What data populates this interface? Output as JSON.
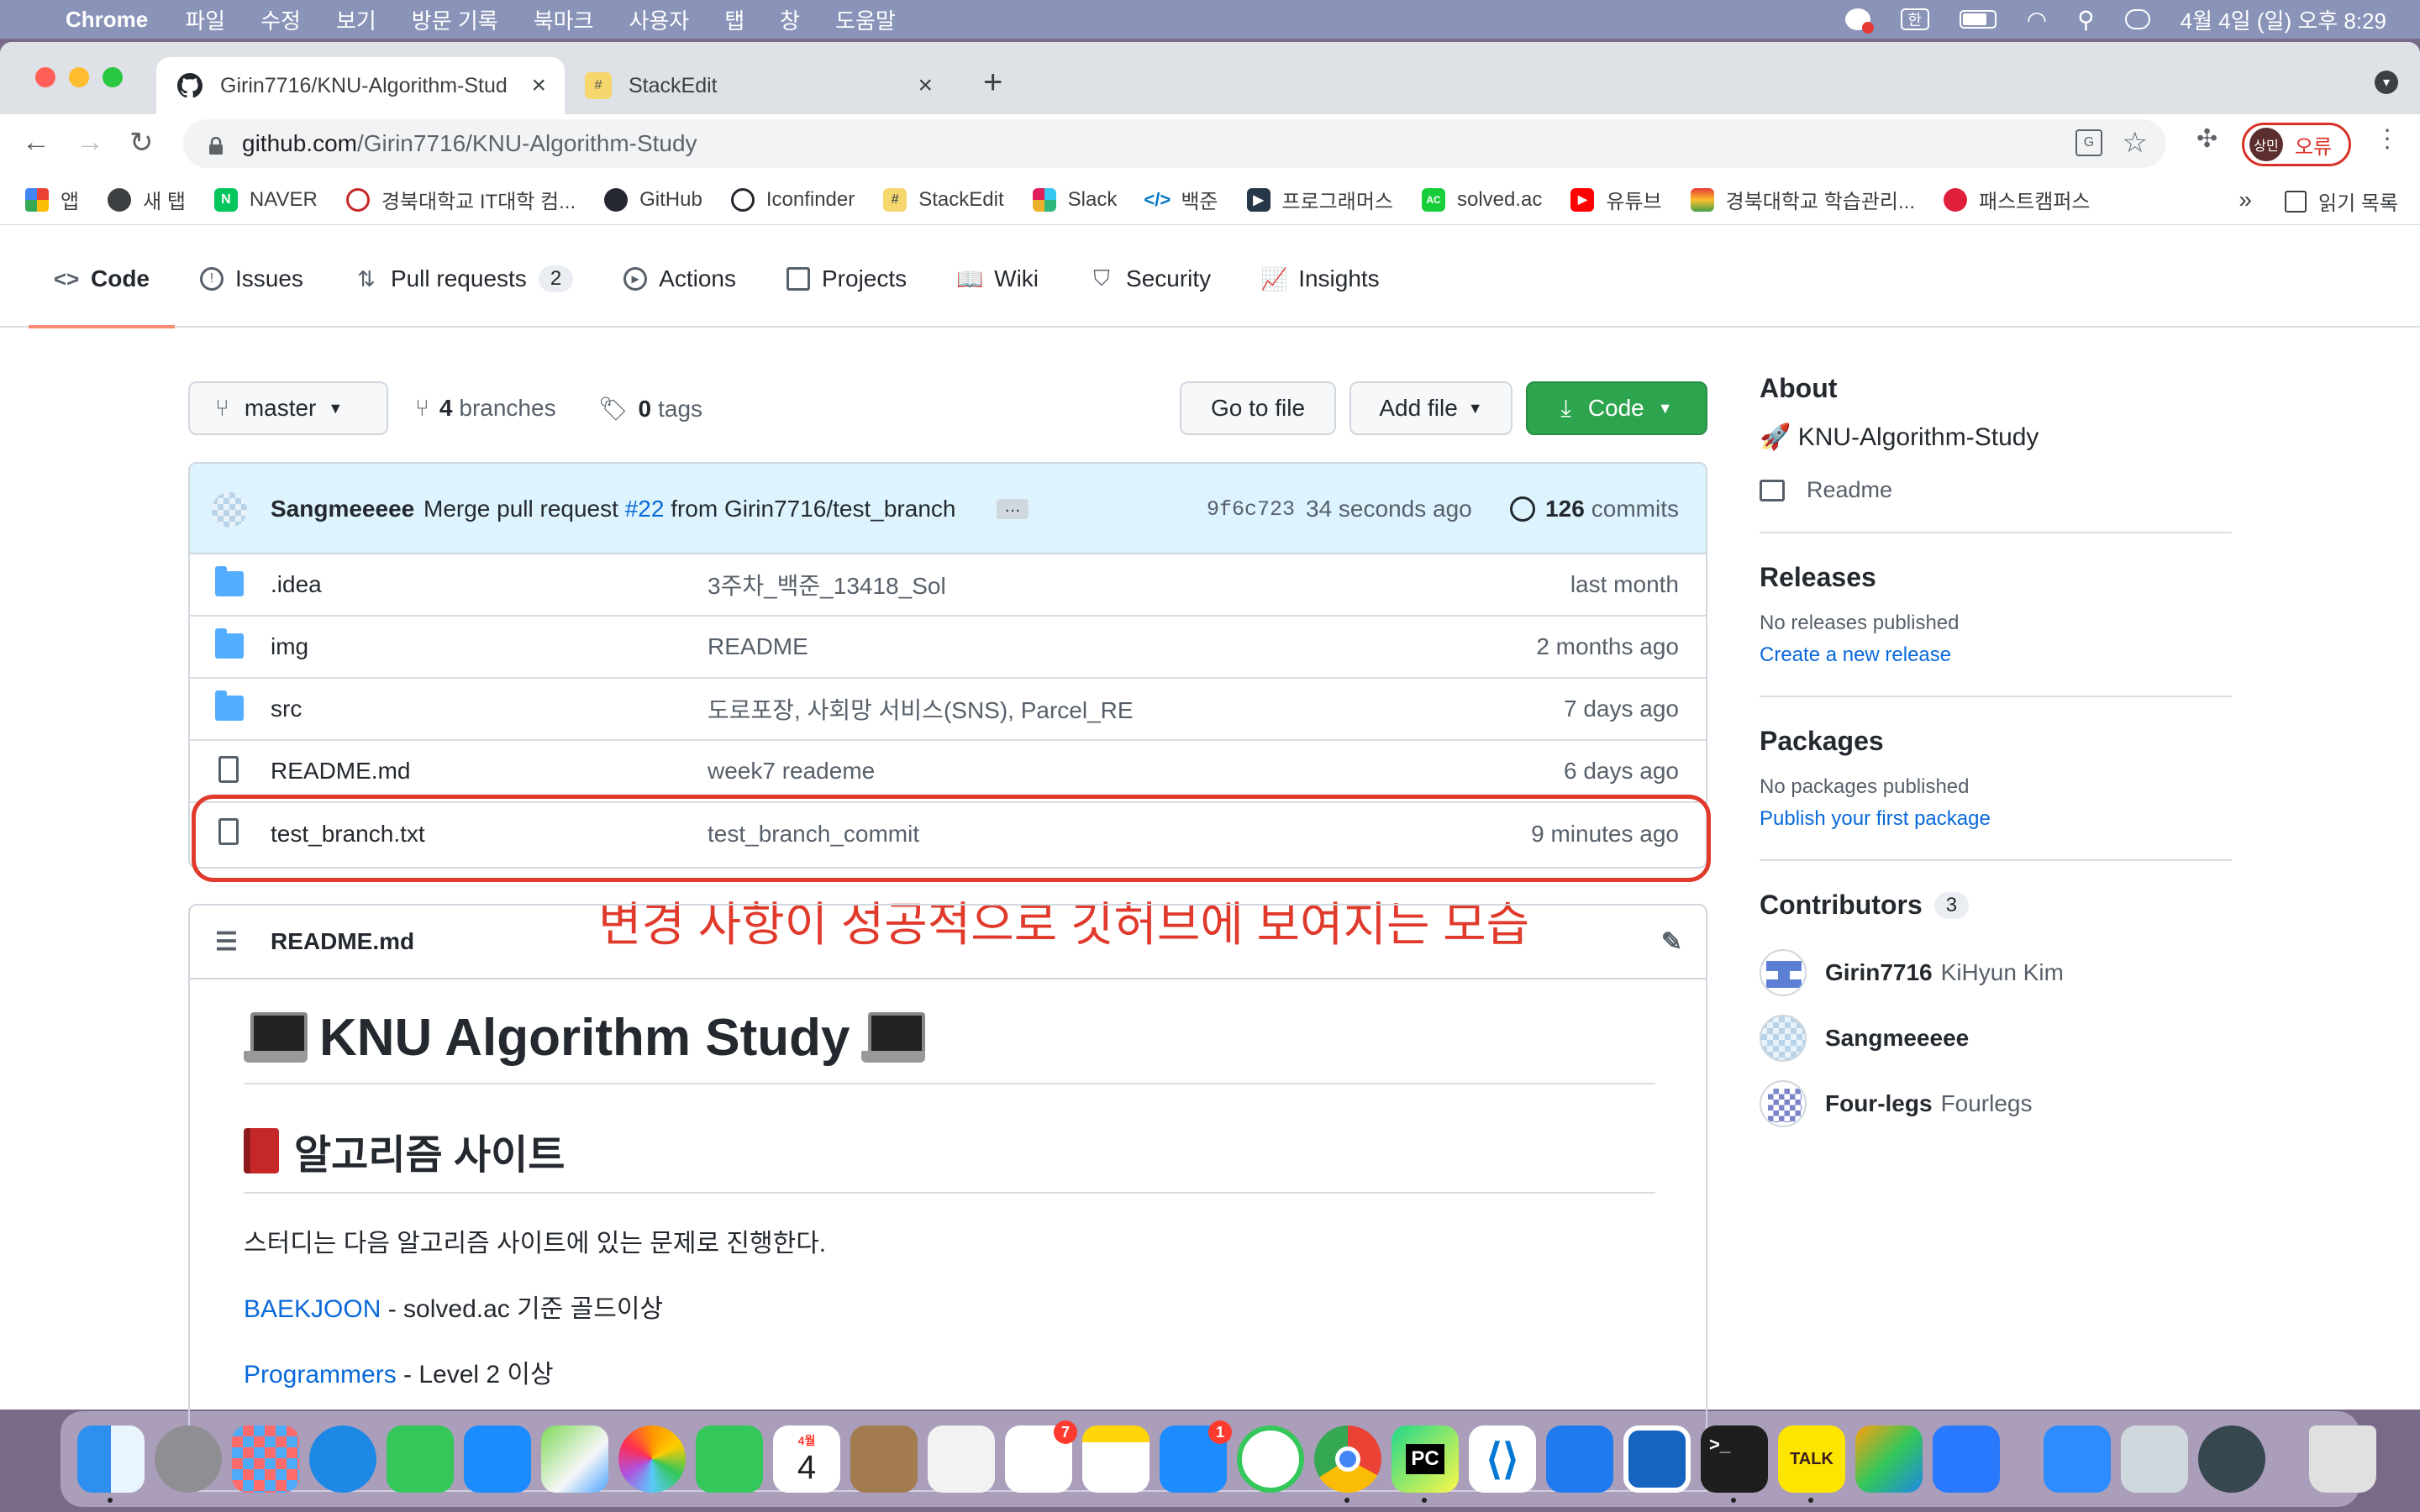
{
  "menubar": {
    "app": "Chrome",
    "items": [
      "파일",
      "수정",
      "보기",
      "방문 기록",
      "북마크",
      "사용자",
      "탭",
      "창",
      "도움말"
    ],
    "ime": "한",
    "clock": "4월 4일 (일) 오후 8:29"
  },
  "tabs": [
    {
      "title": "Girin7716/KNU-Algorithm-Stud"
    },
    {
      "title": "StackEdit"
    }
  ],
  "omnibox": {
    "host": "github.com",
    "path": "/Girin7716/KNU-Algorithm-Study"
  },
  "profile": {
    "avatar": "상민",
    "label": "오류"
  },
  "bookmarks": [
    {
      "label": "앱"
    },
    {
      "label": "새 탭"
    },
    {
      "label": "NAVER"
    },
    {
      "label": "경북대학교 IT대학 컴..."
    },
    {
      "label": "GitHub"
    },
    {
      "label": "Iconfinder"
    },
    {
      "label": "StackEdit"
    },
    {
      "label": "Slack"
    },
    {
      "label": "백준"
    },
    {
      "label": "프로그래머스"
    },
    {
      "label": "solved.ac"
    },
    {
      "label": "유튜브"
    },
    {
      "label": "경북대학교 학습관리..."
    },
    {
      "label": "패스트캠퍼스"
    }
  ],
  "bookmarks_more": "»",
  "reading_list": "읽기 목록",
  "repo_tabs": [
    {
      "label": "Code"
    },
    {
      "label": "Issues"
    },
    {
      "label": "Pull requests",
      "count": "2"
    },
    {
      "label": "Actions"
    },
    {
      "label": "Projects"
    },
    {
      "label": "Wiki"
    },
    {
      "label": "Security"
    },
    {
      "label": "Insights"
    }
  ],
  "controls": {
    "branch": "master",
    "branches_count": "4",
    "branches_label": "branches",
    "tags_count": "0",
    "tags_label": "tags",
    "go_to_file": "Go to file",
    "add_file": "Add file",
    "code": "Code"
  },
  "commit": {
    "author": "Sangmeeeee",
    "message_pre": "Merge pull request",
    "pr": "#22",
    "message_post": "from Girin7716/test_branch",
    "more": "…",
    "sha": "9f6c723",
    "age": "34 seconds ago",
    "count": "126",
    "count_label": "commits"
  },
  "files": [
    {
      "type": "dir",
      "name": ".idea",
      "message": "3주차_백준_13418_Sol",
      "age": "last month"
    },
    {
      "type": "dir",
      "name": "img",
      "message": "README",
      "age": "2 months ago"
    },
    {
      "type": "dir",
      "name": "src",
      "message": "도로포장, 사회망 서비스(SNS), Parcel_RE",
      "age": "7 days ago"
    },
    {
      "type": "file",
      "name": "README.md",
      "message": "week7 reademe",
      "age": "6 days ago"
    },
    {
      "type": "file",
      "name": "test_branch.txt",
      "message": "test_branch_commit",
      "age": "9 minutes ago"
    }
  ],
  "annotation": "변경 사항이 성공적으로 깃허브에 보여지는 모습",
  "readme": {
    "filename": "README.md",
    "h1": "KNU Algorithm Study",
    "h2": "알고리즘 사이트",
    "p1": "스터디는 다음 알고리즘 사이트에 있는 문제로 진행한다.",
    "link1": "BAEKJOON",
    "link1_rest": " - solved.ac 기준 골드이상",
    "link2": "Programmers",
    "link2_rest": " - Level 2 이상"
  },
  "about": {
    "heading": "About",
    "description": "🚀 KNU-Algorithm-Study",
    "readme": "Readme"
  },
  "releases": {
    "heading": "Releases",
    "none": "No releases published",
    "link": "Create a new release"
  },
  "packages": {
    "heading": "Packages",
    "none": "No packages published",
    "link": "Publish your first package"
  },
  "contributors": {
    "heading": "Contributors",
    "count": "3",
    "people": [
      {
        "login": "Girin7716",
        "name": "KiHyun Kim"
      },
      {
        "login": "Sangmeeeee",
        "name": ""
      },
      {
        "login": "Four-legs",
        "name": "Fourlegs"
      }
    ]
  },
  "dock": {
    "calendar_month": "4월",
    "calendar_day": "4",
    "reminders_badge": "7",
    "appstore_badge": "1",
    "terminal_prompt": ">_",
    "kakao": "TALK",
    "pycharm": "PC"
  },
  "colors": {
    "accent": "#0969da",
    "green": "#2da44e",
    "annotation": "#e03a2c",
    "tab_underline": "#fd8c73"
  }
}
